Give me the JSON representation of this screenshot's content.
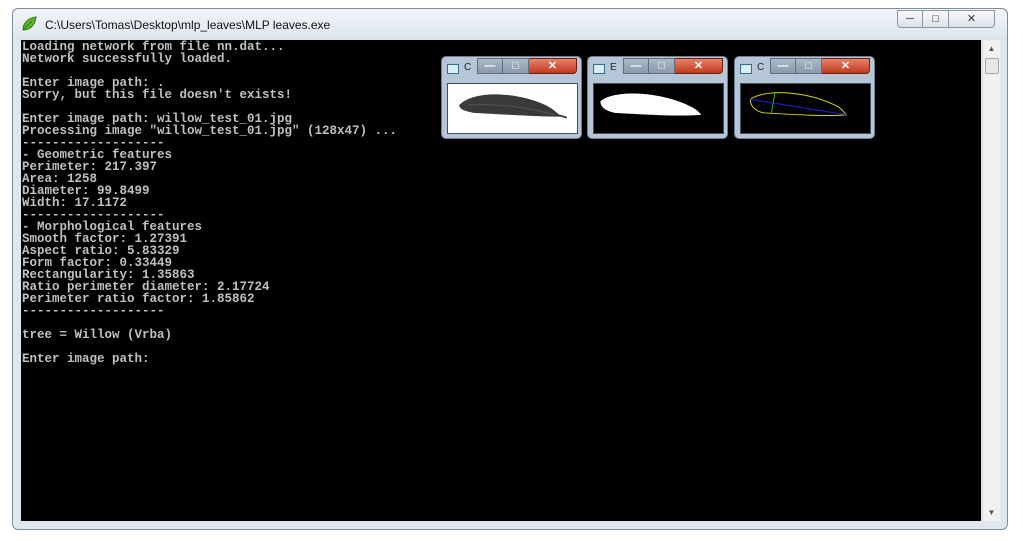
{
  "window": {
    "title": "C:\\Users\\Tomas\\Desktop\\mlp_leaves\\MLP leaves.exe"
  },
  "console": {
    "lines": [
      "Loading network from file nn.dat...",
      "Network successfully loaded.",
      "",
      "Enter image path: .",
      "Sorry, but this file doesn't exists!",
      "",
      "Enter image path: willow_test_01.jpg",
      "Processing image \"willow_test_01.jpg\" (128x47) ...",
      "-------------------",
      "- Geometric features",
      "Perimeter: 217.397",
      "Area: 1258",
      "Diameter: 99.8499",
      "Width: 17.1172",
      "-------------------",
      "- Morphological features",
      "Smooth factor: 1.27391",
      "Aspect ratio: 5.83329",
      "Form factor: 0.33449",
      "Rectangularity: 1.35863",
      "Ratio perimeter diameter: 2.17724",
      "Perimeter ratio factor: 1.85862",
      "-------------------",
      "",
      "tree = Willow (Vrba)",
      "",
      "Enter image path: "
    ]
  },
  "image_windows": [
    {
      "label": "C",
      "content": "grayscale-leaf"
    },
    {
      "label": "E",
      "content": "binary-leaf"
    },
    {
      "label": "C",
      "content": "contour-leaf"
    }
  ],
  "colors": {
    "console_bg": "#000000",
    "console_text": "#c0c0c0",
    "close_red": "#c8452a",
    "contour_yellow": "#d8d800",
    "axis_blue": "#2020e0"
  },
  "icons": {
    "app": "leaf-icon",
    "minimize": "minimize-icon",
    "maximize": "maximize-icon",
    "close": "close-icon"
  }
}
